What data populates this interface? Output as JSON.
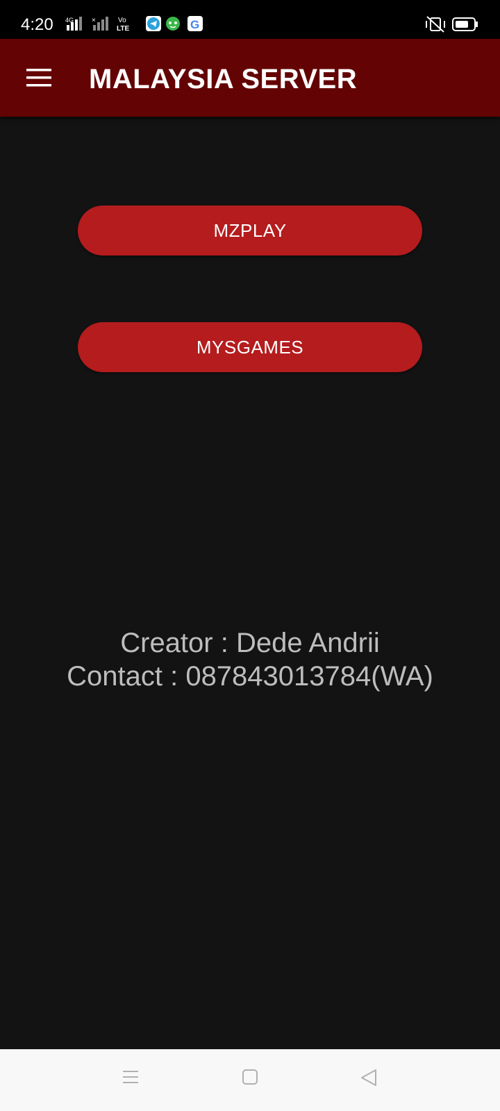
{
  "status_bar": {
    "time": "4:20",
    "network_label": "4G",
    "volte_label": "Vo LTE",
    "left_icons": [
      "signal-4g-icon",
      "signal-no-service-icon",
      "volte-icon",
      "telegram-icon",
      "android-bot-icon",
      "google-icon"
    ],
    "right_icons": [
      "vibrate-off-icon",
      "battery-icon"
    ]
  },
  "app_bar": {
    "title": "MALAYSIA SERVER",
    "menu_icon": "hamburger-menu-icon"
  },
  "buttons": [
    {
      "label": "MZPLAY"
    },
    {
      "label": "MYSGAMES"
    }
  ],
  "credits": {
    "creator": "Creator : Dede Andrii",
    "contact": "Contact : 087843013784(WA)"
  },
  "nav_bar": {
    "icons": [
      "recents-menu-icon",
      "home-square-icon",
      "back-triangle-icon"
    ]
  },
  "colors": {
    "app_bar": "#640303",
    "button": "#b41c1e",
    "background": "#131313",
    "text_muted": "#bdbdbd"
  }
}
